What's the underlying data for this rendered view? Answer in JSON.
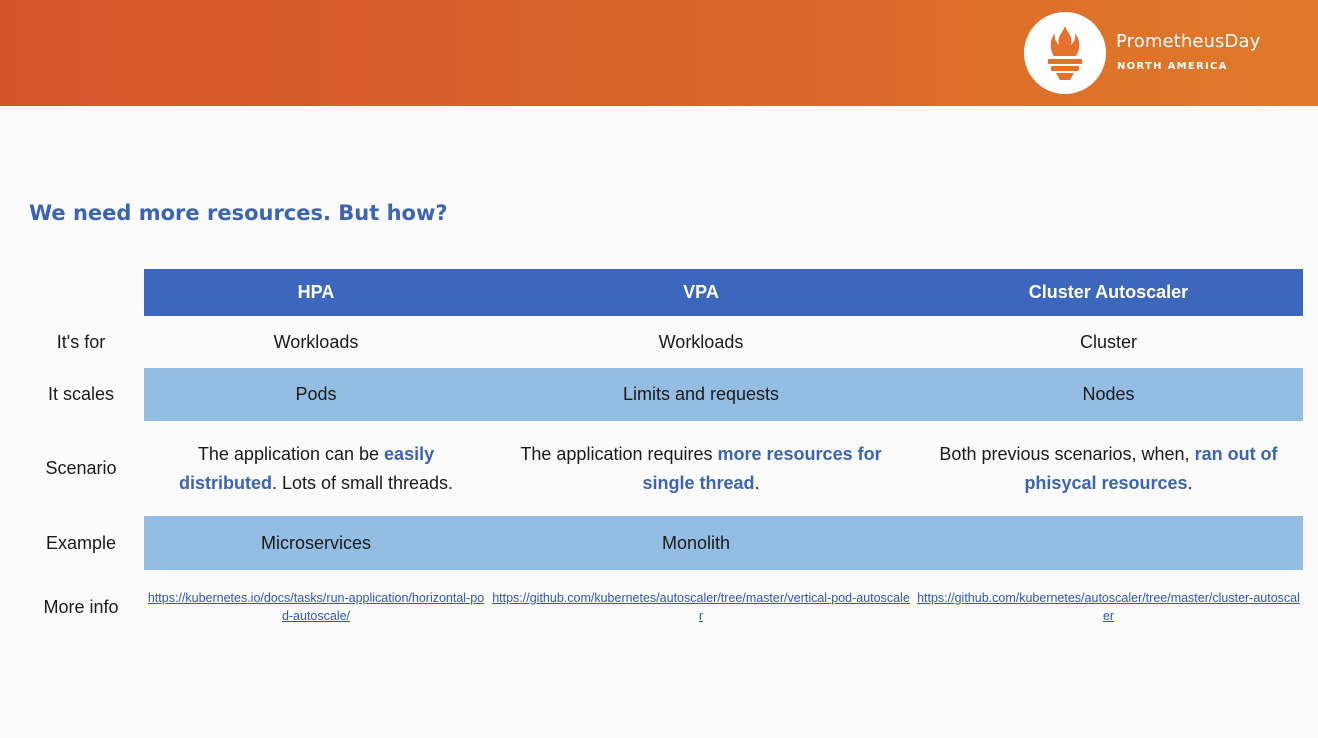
{
  "brand": {
    "name": "PrometheusDay",
    "region": "NORTH AMERICA",
    "accent": "#d8612a"
  },
  "slide": {
    "title": "We need more resources. But how?"
  },
  "table": {
    "columns": [
      "HPA",
      "VPA",
      "Cluster Autoscaler"
    ],
    "rows": {
      "for": {
        "label": "It's for",
        "values": [
          "Workloads",
          "Workloads",
          "Cluster"
        ]
      },
      "scales": {
        "label": "It scales",
        "values": [
          "Pods",
          "Limits and requests",
          "Nodes"
        ]
      },
      "scenario": {
        "label": "Scenario",
        "hpa": {
          "pre": "The application can be ",
          "highlight": "easily distributed",
          "post": ". Lots of small threads."
        },
        "vpa": {
          "pre": "The application requires ",
          "highlight": "more resources for single thread",
          "post": "."
        },
        "ca": {
          "pre": "Both previous scenarios, when, ",
          "highlight": "ran out of phisycal resources",
          "post": "."
        }
      },
      "example": {
        "label": "Example",
        "values": [
          "Microservices",
          "Monolith",
          ""
        ]
      },
      "info": {
        "label": "More info",
        "links": [
          "https://kubernetes.io/docs/tasks/run-application/horizontal-pod-autoscale/",
          "https://github.com/kubernetes/autoscaler/tree/master/vertical-pod-autoscaler",
          "https://github.com/kubernetes/autoscaler/tree/master/cluster-autoscaler"
        ]
      }
    }
  }
}
